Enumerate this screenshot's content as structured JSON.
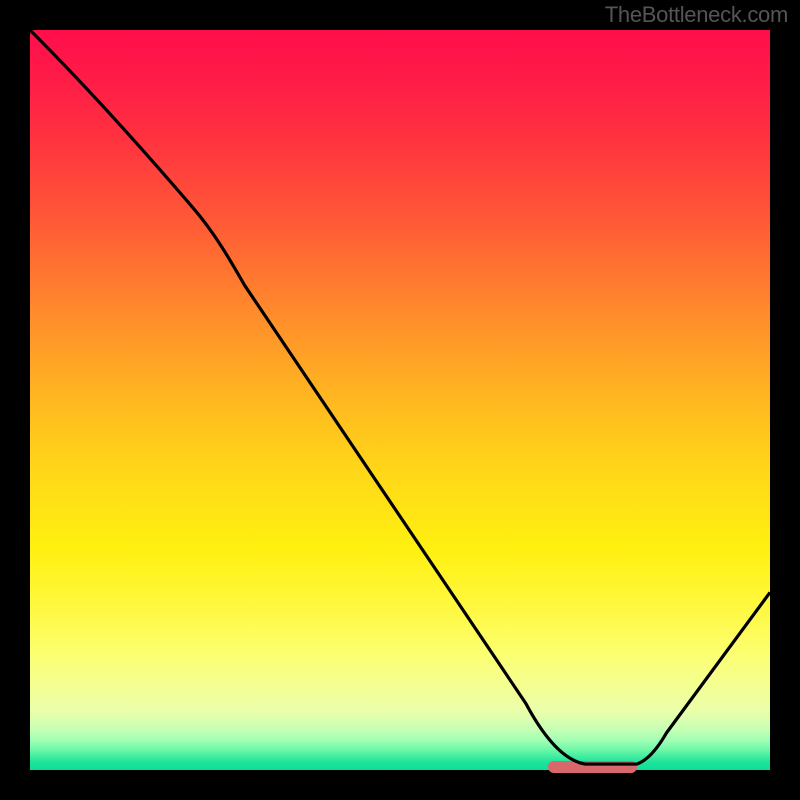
{
  "attribution": "TheBottleneck.com",
  "chart_data": {
    "type": "line",
    "title": "",
    "xlabel": "",
    "ylabel": "",
    "xlim": [
      0,
      100
    ],
    "ylim": [
      0,
      100
    ],
    "x": [
      0,
      22,
      45,
      68,
      75,
      82,
      100
    ],
    "values": [
      100,
      76,
      42,
      8,
      0,
      0,
      24
    ],
    "marker_range_x": [
      70,
      82
    ],
    "marker_y": 0,
    "gradient_stops": [
      {
        "pos": 0,
        "color": "#ff0e4a"
      },
      {
        "pos": 50,
        "color": "#ffd818"
      },
      {
        "pos": 100,
        "color": "#0fde98"
      }
    ]
  }
}
